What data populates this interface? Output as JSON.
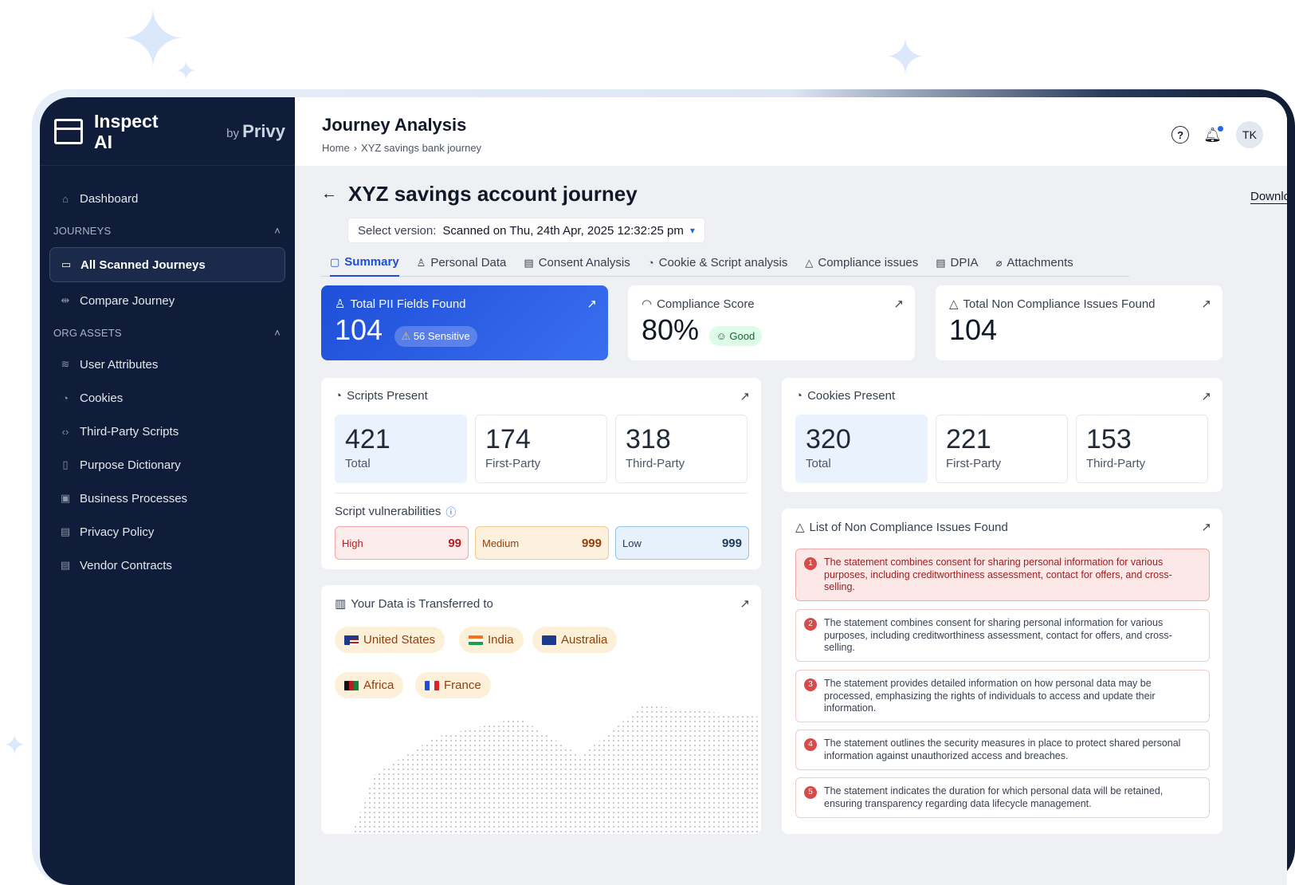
{
  "brand": {
    "name_line1": "Inspect",
    "name_line2": "AI",
    "by": "by",
    "company": "Privy"
  },
  "sidebar": {
    "dashboard": "Dashboard",
    "journeys_section": "JOURNEYS",
    "all_scanned": "All Scanned Journeys",
    "compare": "Compare Journey",
    "org_section": "ORG ASSETS",
    "org_items": [
      "User Attributes",
      "Cookies",
      "Third-Party Scripts",
      "Purpose Dictionary",
      "Business Processes",
      "Privacy Policy",
      "Vendor Contracts"
    ]
  },
  "header": {
    "title": "Journey Analysis",
    "crumb_home": "Home",
    "crumb_current": "XYZ savings bank journey",
    "avatar": "TK"
  },
  "journey": {
    "title": "XYZ savings account journey",
    "download": "Download",
    "version_label": "Select version:",
    "version_value": "Scanned on Thu, 24th Apr, 2025  12:32:25 pm"
  },
  "tabs": [
    "Summary",
    "Personal Data",
    "Consent Analysis",
    "Cookie & Script analysis",
    "Compliance issues",
    "DPIA",
    "Attachments"
  ],
  "pii": {
    "title": "Total PII Fields Found",
    "value": "104",
    "sensitive": "56 Sensitive"
  },
  "compliance": {
    "title": "Compliance Score",
    "value": "80%",
    "badge": "Good"
  },
  "noncompliance": {
    "title": "Total Non Compliance Issues Found",
    "value": "104"
  },
  "scripts": {
    "title": "Scripts Present",
    "total": "421",
    "total_label": "Total",
    "first": "174",
    "first_label": "First-Party",
    "third": "318",
    "third_label": "Third-Party",
    "vuln_title": "Script vulnerabilities",
    "high_label": "High",
    "high": "99",
    "medium_label": "Medium",
    "medium": "999",
    "low_label": "Low",
    "low": "999"
  },
  "cookies": {
    "title": "Cookies Present",
    "total": "320",
    "total_label": "Total",
    "first": "221",
    "first_label": "First-Party",
    "third": "153",
    "third_label": "Third-Party"
  },
  "transfer": {
    "title": "Your Data is Transferred to",
    "countries": [
      "United States",
      "India",
      "Australia",
      "Africa",
      "France"
    ]
  },
  "issues": {
    "title": "List of Non Compliance Issues Found",
    "items": [
      "The statement combines consent for sharing personal information for various purposes, including creditworthiness assessment, contact for offers, and cross-selling.",
      "The statement combines consent for sharing personal information for various purposes, including creditworthiness assessment, contact for offers, and cross-selling.",
      "The statement provides detailed information on how personal data may be processed, emphasizing the rights of individuals to access and update their information.",
      "The statement outlines the security measures in place to protect shared personal information against unauthorized access and breaches.",
      "The statement indicates the duration for which personal data will be retained, ensuring transparency regarding data lifecycle management."
    ],
    "numbers": [
      "1",
      "2",
      "3",
      "4",
      "5"
    ]
  },
  "colors": {
    "sidebar": "#0f1d3a",
    "accent": "#1d4ed8",
    "danger": "#d94b4b"
  }
}
